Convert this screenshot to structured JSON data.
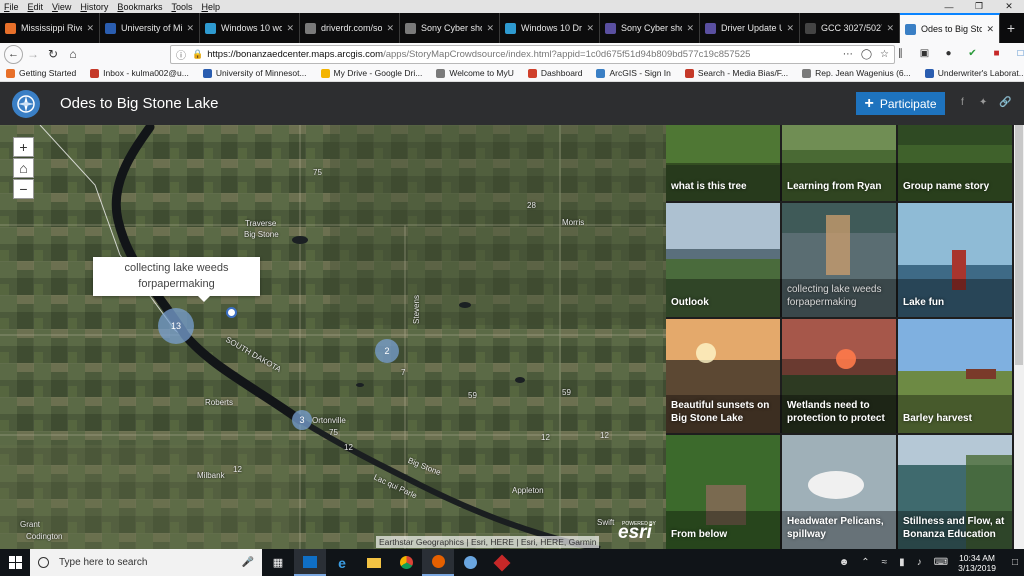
{
  "browser": {
    "menu": [
      "File",
      "Edit",
      "View",
      "History",
      "Bookmarks",
      "Tools",
      "Help"
    ],
    "tabs": [
      {
        "label": "Mississippi River",
        "color": "#e8702a"
      },
      {
        "label": "University of Mi",
        "color": "#2a5db0"
      },
      {
        "label": "Windows 10 wo",
        "color": "#2e9ad0"
      },
      {
        "label": "driverdr.com/so",
        "color": "#7a7a7a"
      },
      {
        "label": "Sony Cyber shot",
        "color": "#7a7a7a"
      },
      {
        "label": "Windows 10 Dri",
        "color": "#2e9ad0"
      },
      {
        "label": "Sony Cyber shot",
        "color": "#5a4fa0"
      },
      {
        "label": "Driver Update U",
        "color": "#5a4fa0"
      },
      {
        "label": "GCC 3027/5027 | Gr",
        "color": "#444444"
      },
      {
        "label": "Odes to Big Ston",
        "color": "#3a7fc5"
      }
    ],
    "url_host": "https://bonanzaedcenter.maps.arcgis.com",
    "url_rest": "/apps/StoryMapCrowdsource/index.html?appid=1c0d675f51d94b809bd577c19c857525",
    "bookmarks": [
      {
        "label": "Getting Started",
        "color": "#e8702a"
      },
      {
        "label": "Inbox - kulma002@u...",
        "color": "#c53929"
      },
      {
        "label": "University of Minnesot...",
        "color": "#2a5db0"
      },
      {
        "label": "My Drive - Google Dri...",
        "color": "#f4b400"
      },
      {
        "label": "Welcome to MyU",
        "color": "#7a7a7a"
      },
      {
        "label": "Dashboard",
        "color": "#d0402b"
      },
      {
        "label": "ArcGIS - Sign In",
        "color": "#3a7fc5"
      },
      {
        "label": "Search - Media Bias/F...",
        "color": "#c53929"
      },
      {
        "label": "Rep. Jean Wagenius (6...",
        "color": "#7a7a7a"
      },
      {
        "label": "Underwriter's Laborat...",
        "color": "#2a5db0"
      }
    ]
  },
  "story": {
    "title": "Odes to Big Stone Lake",
    "participate_label": "Participate"
  },
  "map": {
    "popup_text": "collecting lake weeds forpapermaking",
    "clusters": [
      {
        "count": "13"
      },
      {
        "count": "2"
      },
      {
        "count": "3"
      }
    ],
    "attribution": "Earthstar Geographics | Esri, HERE | Esri, HERE, Garmin",
    "powered_by": "POWERED BY",
    "brand": "esri",
    "labels": [
      "Traverse",
      "Big Stone",
      "Morris",
      "Stevens",
      "Roberts",
      "Ortonville",
      "Milbank",
      "Grant",
      "Codington",
      "Appleton",
      "Lac qui Parle",
      "Big Stone",
      "SOUTH DAKOTA",
      "Swift",
      "75",
      "28",
      "59",
      "7",
      "12",
      "12",
      "12",
      "75",
      "59",
      "12"
    ]
  },
  "gallery": {
    "tiles": [
      {
        "label": "what is this tree",
        "dim": false
      },
      {
        "label": "Learning from Ryan",
        "dim": false
      },
      {
        "label": "Group name story",
        "dim": false
      },
      {
        "label": "Outlook",
        "dim": false
      },
      {
        "label": "collecting lake weeds forpapermaking",
        "dim": true
      },
      {
        "label": "Lake fun",
        "dim": false
      },
      {
        "label": "Beautiful sunsets on Big Stone Lake",
        "dim": false
      },
      {
        "label": "Wetlands need to protection to protect",
        "dim": false
      },
      {
        "label": "Barley harvest",
        "dim": false
      },
      {
        "label": "From below",
        "dim": false
      },
      {
        "label": "Headwater Pelicans, spillway",
        "dim": false
      },
      {
        "label": "Stillness and Flow, at Bonanza Education",
        "dim": false
      }
    ]
  },
  "taskbar": {
    "search_placeholder": "Type here to search",
    "time": "10:34 AM",
    "date": "3/13/2019"
  }
}
